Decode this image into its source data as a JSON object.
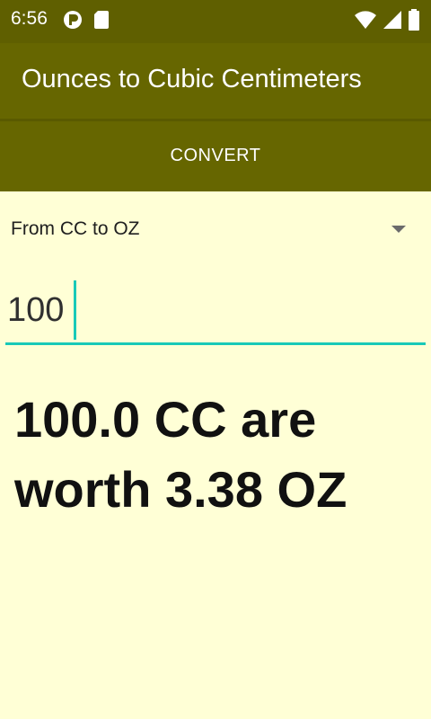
{
  "status_bar": {
    "time": "6:56",
    "left_icons": [
      "notification-app-icon",
      "sim-card-icon"
    ],
    "right_icons": [
      "wifi-icon",
      "cellular-signal-icon",
      "battery-icon"
    ]
  },
  "app_bar": {
    "title": "Ounces to Cubic Centimeters"
  },
  "convert_button": {
    "label": "CONVERT"
  },
  "spinner": {
    "selected": "From CC to OZ"
  },
  "input": {
    "value": "100"
  },
  "result": {
    "text": "100.0 CC are worth 3.38 OZ"
  },
  "colors": {
    "primary_dark": "#5f5f00",
    "primary": "#666600",
    "background": "#ffffd6",
    "accent": "#18c9b8"
  }
}
